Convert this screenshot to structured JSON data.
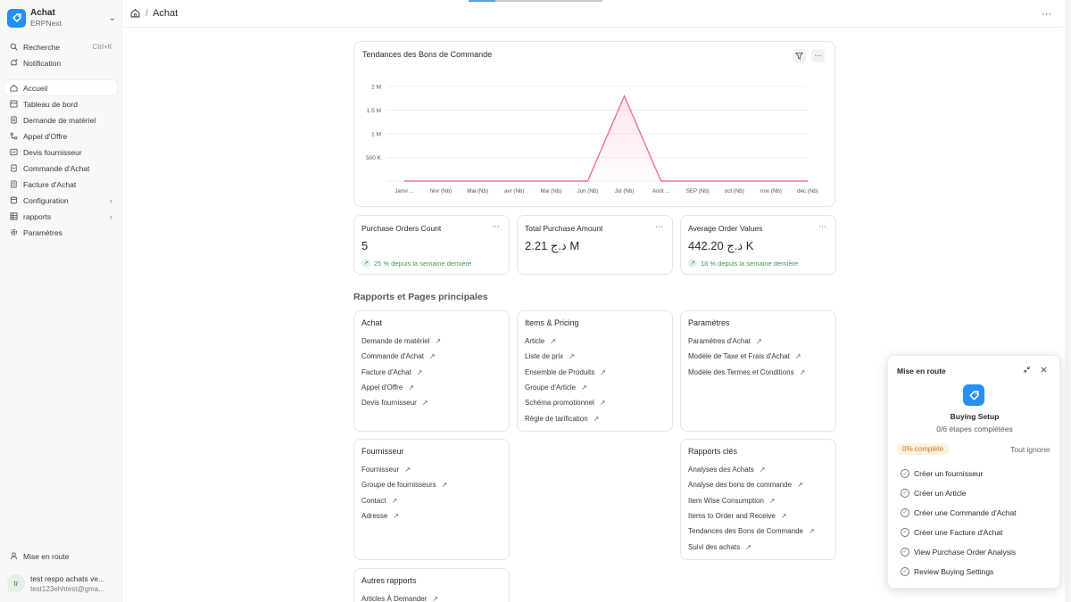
{
  "app": {
    "title": "Achat",
    "subtitle": "ERPNext"
  },
  "sidebar": {
    "search_label": "Recherche",
    "search_shortcut": "Ctrl+K",
    "notification_label": "Notification",
    "items": [
      {
        "label": "Accueil",
        "icon": "home-icon"
      },
      {
        "label": "Tableau de bord",
        "icon": "dashboard-icon"
      },
      {
        "label": "Demande de matériel",
        "icon": "document-icon"
      },
      {
        "label": "Appel d'Offre",
        "icon": "share-icon"
      },
      {
        "label": "Devis fournisseur",
        "icon": "list-icon"
      },
      {
        "label": "Commande d'Achat",
        "icon": "file-icon"
      },
      {
        "label": "Facture d'Achat",
        "icon": "receipt-icon"
      },
      {
        "label": "Configuration",
        "icon": "database-icon"
      },
      {
        "label": "rapports",
        "icon": "table-icon"
      },
      {
        "label": "Paramètres",
        "icon": "gear-icon"
      }
    ],
    "onboarding_label": "Mise en route",
    "user": {
      "initials": "tr",
      "name": "test respo achats ve...",
      "email": "test123ehhtest@gma..."
    }
  },
  "breadcrumb": {
    "current": "Achat"
  },
  "chart_card": {
    "title": "Tendances des Bons de Commande"
  },
  "chart_data": {
    "type": "area",
    "title": "Tendances des Bons de Commande",
    "categories": [
      "Janvi ...",
      "févr (Nb)",
      "Mai (Nb)",
      "avr (Nb)",
      "Mai (Nb)",
      "Jun (Nb)",
      "Jul (Nb)",
      "Août ...",
      "SEP (Nb)",
      "oct (Nb)",
      "nov (Nb)",
      "déc (Nb)"
    ],
    "series": [
      {
        "values": [
          0,
          0,
          0,
          0,
          0,
          0,
          1800000,
          0,
          0,
          0,
          0,
          0
        ]
      }
    ],
    "yticks": [
      "500 K",
      "1 M",
      "1.5 M",
      "2 M"
    ],
    "ylim": [
      0,
      2000000
    ],
    "color": "#f26fa0",
    "grid": true
  },
  "kpis": [
    {
      "title": "Purchase Orders Count",
      "value": "5",
      "trend": "25 % depuis la semaine dernière"
    },
    {
      "title": "Total Purchase Amount",
      "value": "2.21 د.ج M",
      "trend": ""
    },
    {
      "title": "Average Order Values",
      "value": "442.20 د.ج K",
      "trend": "18 % depuis la semaine dernière"
    }
  ],
  "section_title": "Rapports et Pages principales",
  "link_cards": [
    {
      "title": "Achat",
      "links": [
        "Demande de matériel",
        "Commande d'Achat",
        "Facture d'Achat",
        "Appel d'Offre",
        "Devis fournisseur"
      ]
    },
    {
      "title": "Items & Pricing",
      "links": [
        "Article",
        "Liste de prix",
        "Ensemble de Produits",
        "Groupe d'Article",
        "Schéma promotionnel",
        "Règle de tarification"
      ]
    },
    {
      "title": "Paramètres",
      "links": [
        "Paramètres d'Achat",
        "Modèle de Taxe et Frais d'Achat",
        "Modèle des Termes et Conditions"
      ]
    },
    {
      "title": "Fournisseur",
      "links": [
        "Fournisseur",
        "Groupe de fournisseurs",
        "Contact",
        "Adresse"
      ]
    },
    {
      "title": "Rapports clés",
      "links": [
        "Analyses des Achats",
        "Analyse des bons de commande",
        "Item Wise Consumption",
        "Items to Order and Receive",
        "Tendances des Bons de Commande",
        "Suivi des achats"
      ]
    },
    {
      "title": "Autres rapports",
      "links": [
        "Articles À Demander"
      ]
    }
  ],
  "onboarding": {
    "title": "Mise en route",
    "setup_name": "Buying Setup",
    "steps_done": "0/6 étapes complétées",
    "progress": "0% complété",
    "skip_all": "Tout ignorer",
    "steps": [
      "Créer un fournisseur",
      "Créer un Article",
      "Créer une Commande d'Achat",
      "Créer une Facture d'Achat",
      "View Purchase Order Analysis",
      "Review Buying Settings"
    ]
  }
}
